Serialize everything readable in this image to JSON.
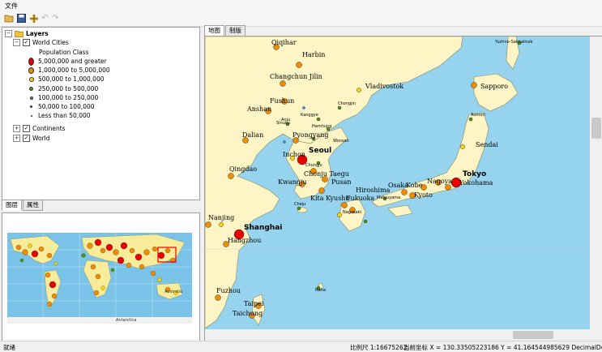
{
  "menu": {
    "file": "文件"
  },
  "toolbar": {
    "icons": [
      "open-folder-icon",
      "save-icon",
      "add-data-icon",
      "undo-icon",
      "redo-icon"
    ]
  },
  "toc": {
    "root": "Layers",
    "world_cities": "World Cities",
    "population_class": "Population Class",
    "legend": [
      {
        "label": "5,000,000 and greater",
        "color": "#e60000"
      },
      {
        "label": "1,000,000 to 5,000,000",
        "color": "#f08c00"
      },
      {
        "label": "500,000 to 1,000,000",
        "color": "#ffd700"
      },
      {
        "label": "250,000 to 500,000",
        "color": "#4e9a06"
      },
      {
        "label": "100,000 to 250,000",
        "color": "#1e90ff"
      },
      {
        "label": "50,000 to 100,000",
        "color": "#7b3fb0"
      },
      {
        "label": "Less than 50,000",
        "color": "#555555"
      }
    ],
    "continents": "Continents",
    "world": "World"
  },
  "left_tabs": {
    "layers": "图层",
    "properties": "属性"
  },
  "overview": {
    "label_antarctica": "Antarctica",
    "label_australia": "Australia"
  },
  "map_tabs": {
    "map": "地图",
    "layout": "制版"
  },
  "map": {
    "labels_large": [
      "Seoul",
      "Tokyo",
      "Shanghai"
    ],
    "labels": [
      "Qiqihar",
      "Harbin",
      "Changchun Jilin",
      "Vladivostok",
      "Sapporo",
      "Fushun",
      "Anshan",
      "Dalian",
      "Pyongyang",
      "Inchon",
      "Qingdao",
      "Chonju Taegu",
      "Kwangju",
      "Pusan",
      "Kita Kyushu",
      "Fukuoka",
      "Hiroshima",
      "Osaka",
      "Kobe",
      "Kyoto",
      "Nagoya",
      "Yokohama",
      "Sendai",
      "Nanjing",
      "Hangzhou",
      "Fuzhou",
      "Taipei",
      "Taichung"
    ],
    "labels_small": [
      "Yuzhno-Sakhalinsk",
      "Chongjin",
      "Kanggye",
      "Hamhung",
      "Sinuiju",
      "Wonsan",
      "Chungju",
      "Cheju",
      "Matsuyama",
      "Nagasaki",
      "Aomori",
      "Naha",
      "Anju"
    ]
  },
  "status": {
    "ready": "就绪",
    "scale": "比例尺 1:16675262",
    "coords": "当前坐标 X = 130.33505223186 Y = 41.164544985629 DecimalDegrees"
  }
}
